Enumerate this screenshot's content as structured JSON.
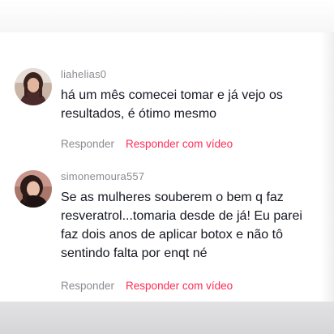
{
  "comments": [
    {
      "username": "liahelias0",
      "text": "há um mês comecei tomar e já vejo os resultados, é ótimo mesmo",
      "reply_label": "Responder",
      "reply_video_label": "Responder com vídeo",
      "avatar_icon": "user-avatar"
    },
    {
      "username": "simonemoura557",
      "text": "Se as mulheres souberem o bem q faz resveratrol...tomaria desde de já! Eu parei faz dois anos de aplicar botox e não tô sentindo falta por enqt né",
      "reply_label": "Responder",
      "reply_video_label": "Responder com vídeo",
      "avatar_icon": "user-avatar"
    }
  ],
  "colors": {
    "username": "#8a8b91",
    "text": "#161823",
    "accent": "#fe2c55"
  }
}
